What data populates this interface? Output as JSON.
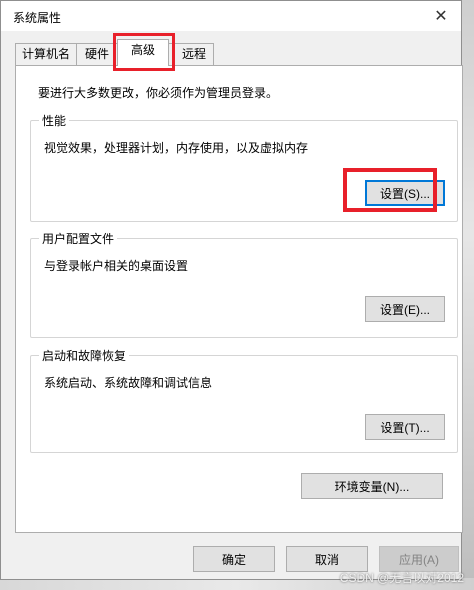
{
  "window": {
    "title": "系统属性",
    "close_glyph": "✕"
  },
  "tabs": [
    {
      "label": "计算机名"
    },
    {
      "label": "硬件"
    },
    {
      "label": "高级",
      "active": true
    },
    {
      "label": "远程"
    }
  ],
  "admin_note": "要进行大多数更改，你必须作为管理员登录。",
  "groups": {
    "performance": {
      "title": "性能",
      "description": "视觉效果，处理器计划，内存使用，以及虚拟内存",
      "button": "设置(S)..."
    },
    "user_profiles": {
      "title": "用户配置文件",
      "description": "与登录帐户相关的桌面设置",
      "button": "设置(E)..."
    },
    "startup_recovery": {
      "title": "启动和故障恢复",
      "description": "系统启动、系统故障和调试信息",
      "button": "设置(T)..."
    }
  },
  "env_vars_button": "环境变量(N)...",
  "footer": {
    "ok": "确定",
    "cancel": "取消",
    "apply": "应用(A)"
  },
  "watermark": "CSDN @无言以对2012",
  "colors": {
    "highlight": "#e8202a",
    "focus": "#0078d7",
    "panel": "#ffffff",
    "dialog": "#f0f0f0"
  },
  "icons": {
    "close": "close-icon"
  }
}
